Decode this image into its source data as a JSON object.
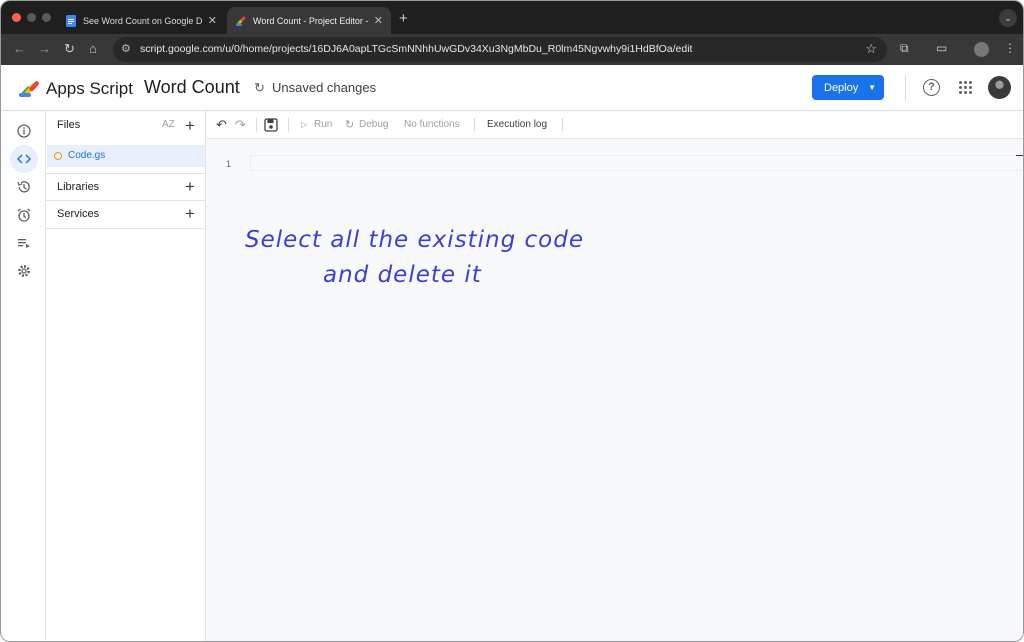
{
  "browser": {
    "tabs": [
      {
        "title": "See Word Count on Google D",
        "icon": "google-docs-icon"
      },
      {
        "title": "Word Count - Project Editor -",
        "icon": "apps-script-icon",
        "active": true
      }
    ],
    "url": "script.google.com/u/0/home/projects/16DJ6A0apLTGcSmNNhhUwGDv34Xu3NgMbDu_R0lm45Ngvwhy9i1HdBfOa/edit"
  },
  "header": {
    "app_name": "Apps Script",
    "project_name": "Word Count",
    "status": "Unsaved changes",
    "deploy_label": "Deploy"
  },
  "rail": {
    "icons": [
      "info-icon",
      "code-icon",
      "history-icon",
      "alarm-icon",
      "executions-icon",
      "settings-icon"
    ]
  },
  "files_panel": {
    "files_title": "Files",
    "sort_label": "AZ",
    "files": [
      "Code.gs"
    ],
    "libraries_title": "Libraries",
    "services_title": "Services"
  },
  "editor_toolbar": {
    "run_label": "Run",
    "debug_label": "Debug",
    "functions_label": "No functions",
    "execution_log_label": "Execution log"
  },
  "editor": {
    "line_numbers": [
      "1"
    ]
  },
  "annotation": {
    "line1": "Select all the existing code",
    "line2": "and delete it"
  },
  "colors": {
    "accent": "#1a73e8",
    "annotation": "#3b3fd8"
  }
}
